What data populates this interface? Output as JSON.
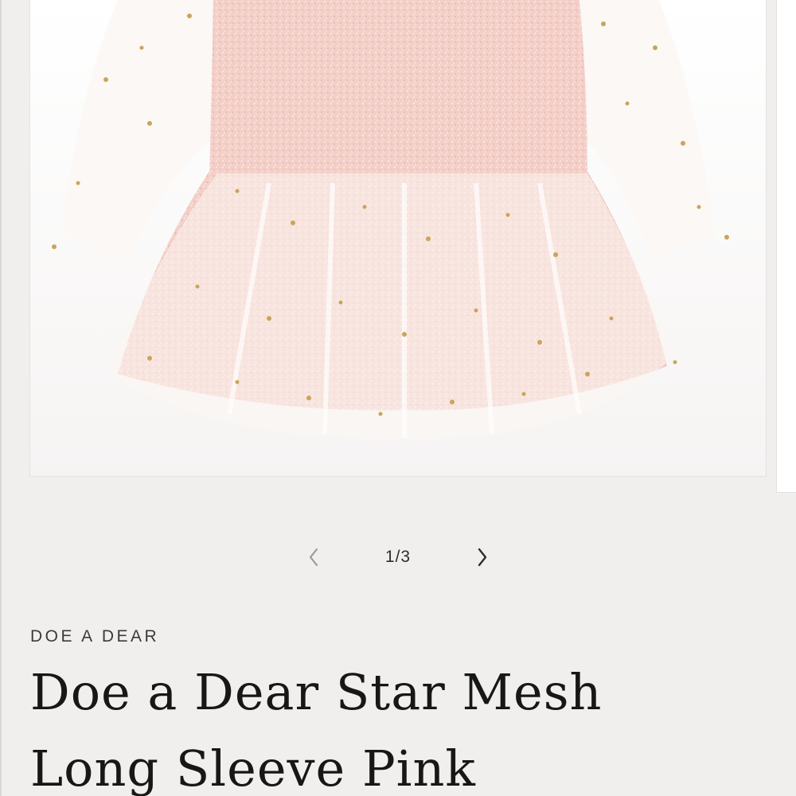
{
  "gallery": {
    "image": {
      "alt": "Doe a Dear Star Mesh Long Sleeve Pink dress with star-printed tulle sleeves and skirt"
    },
    "slider": {
      "counter": "1/3",
      "prev_icon": "chevron-left-icon",
      "next_icon": "chevron-right-icon"
    }
  },
  "product": {
    "vendor": "DOE A DEAR",
    "title": "Doe a Dear Star Mesh Long Sleeve Pink"
  },
  "colors": {
    "page_background": "#f1efee",
    "tweed_pink": "#f3cfc8",
    "tulle_white": "#fbf7f3",
    "star_gold": "#c9a55a",
    "text_dark": "#171717"
  }
}
